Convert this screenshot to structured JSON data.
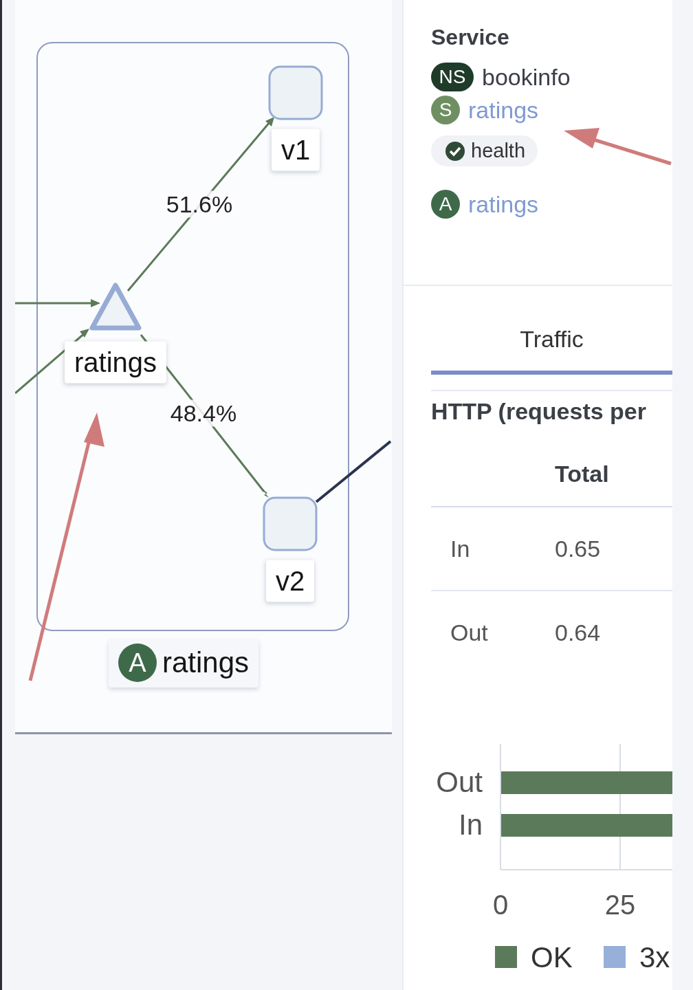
{
  "graph": {
    "box_label": {
      "badge": "A",
      "name": "ratings"
    },
    "nodes": [
      {
        "kind": "service",
        "label": "ratings"
      },
      {
        "kind": "workload",
        "label": "v1"
      },
      {
        "kind": "workload",
        "label": "v2"
      }
    ],
    "edges": [
      {
        "label": "51.6%"
      },
      {
        "label": "48.4%"
      }
    ]
  },
  "side_panel": {
    "title": "Service",
    "items": [
      {
        "badge": "NS",
        "text": "bookinfo",
        "kind": "namespace"
      },
      {
        "badge": "S",
        "text": "ratings",
        "kind": "service"
      },
      {
        "text": "health",
        "kind": "health"
      },
      {
        "badge": "A",
        "text": "ratings",
        "kind": "app"
      }
    ],
    "tabs": [
      {
        "label": "Traffic",
        "selected": true
      }
    ],
    "section_title": "HTTP (requests per",
    "table": {
      "columns": [
        "",
        "Total"
      ],
      "rows": [
        [
          "In",
          "0.65"
        ],
        [
          "Out",
          "0.64"
        ]
      ]
    },
    "chart": {
      "categories": [
        "Out",
        "In"
      ],
      "ticks": [
        "0",
        "25"
      ],
      "legend": [
        {
          "name": "OK",
          "color": "#5b7a5a"
        },
        {
          "name": "3x",
          "color": "#97b0da"
        }
      ]
    }
  }
}
